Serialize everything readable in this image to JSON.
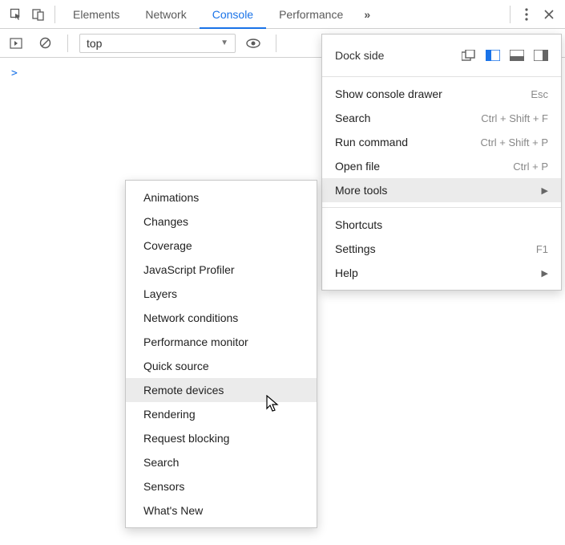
{
  "tabs": {
    "elements": "Elements",
    "network": "Network",
    "console": "Console",
    "performance": "Performance"
  },
  "context": "top",
  "prompt": ">",
  "menu": {
    "dock_side": "Dock side",
    "show_drawer": "Show console drawer",
    "show_drawer_sc": "Esc",
    "search": "Search",
    "search_sc": "Ctrl + Shift + F",
    "run_cmd": "Run command",
    "run_cmd_sc": "Ctrl + Shift + P",
    "open_file": "Open file",
    "open_file_sc": "Ctrl + P",
    "more_tools": "More tools",
    "shortcuts": "Shortcuts",
    "settings": "Settings",
    "settings_sc": "F1",
    "help": "Help"
  },
  "tools": {
    "animations": "Animations",
    "changes": "Changes",
    "coverage": "Coverage",
    "js_profiler": "JavaScript Profiler",
    "layers": "Layers",
    "net_cond": "Network conditions",
    "perf_mon": "Performance monitor",
    "quick_src": "Quick source",
    "remote_dev": "Remote devices",
    "rendering": "Rendering",
    "req_block": "Request blocking",
    "search": "Search",
    "sensors": "Sensors",
    "whats_new": "What's New"
  }
}
